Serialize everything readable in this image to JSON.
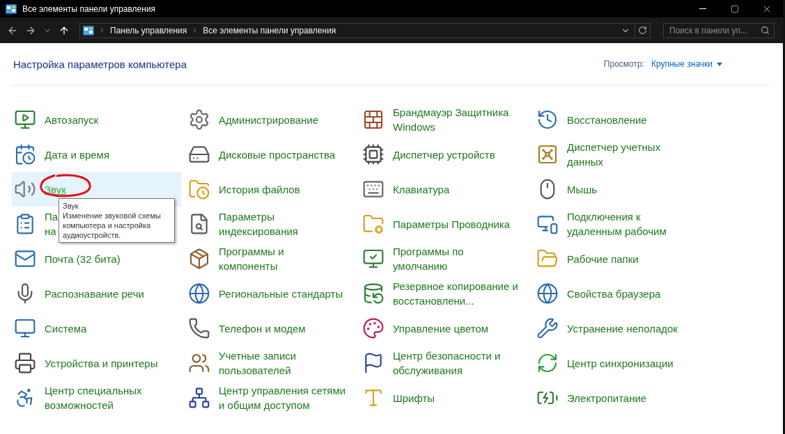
{
  "window": {
    "title": "Все элементы панели управления"
  },
  "breadcrumb": [
    "Панель управления",
    "Все элементы панели управления"
  ],
  "search": {
    "placeholder": "Поиск в панели уп..."
  },
  "heading": "Настройка параметров компьютера",
  "view": {
    "label": "Просмотр:",
    "value": "Крупные значки"
  },
  "items": [
    {
      "lines": [
        "Автозапуск"
      ],
      "hovered": false
    },
    {
      "lines": [
        "Администрирование"
      ],
      "hovered": false
    },
    {
      "lines": [
        "Брандмауэр Защитника",
        "Windows"
      ],
      "hovered": false
    },
    {
      "lines": [
        "Восстановление"
      ],
      "hovered": false
    },
    {
      "lines": [
        "Дата и время"
      ],
      "hovered": false
    },
    {
      "lines": [
        "Дисковые пространства"
      ],
      "hovered": false
    },
    {
      "lines": [
        "Диспетчер устройств"
      ],
      "hovered": false
    },
    {
      "lines": [
        "Диспетчер учетных",
        "данных"
      ],
      "hovered": false
    },
    {
      "lines": [
        "Звук"
      ],
      "hovered": true
    },
    {
      "lines": [
        "История файлов"
      ],
      "hovered": false
    },
    {
      "lines": [
        "Клавиатура"
      ],
      "hovered": false
    },
    {
      "lines": [
        "Мышь"
      ],
      "hovered": false
    },
    {
      "lines": [
        "Па",
        "на"
      ],
      "hovered": false
    },
    {
      "lines": [
        "Параметры",
        "индексирования"
      ],
      "hovered": false
    },
    {
      "lines": [
        "Параметры Проводника"
      ],
      "hovered": false
    },
    {
      "lines": [
        "Подключения к",
        "удаленным рабочим"
      ],
      "hovered": false
    },
    {
      "lines": [
        "Почта (32 бита)"
      ],
      "hovered": false
    },
    {
      "lines": [
        "Программы и",
        "компоненты"
      ],
      "hovered": false
    },
    {
      "lines": [
        "Программы по",
        "умолчанию"
      ],
      "hovered": false
    },
    {
      "lines": [
        "Рабочие папки"
      ],
      "hovered": false
    },
    {
      "lines": [
        "Распознавание речи"
      ],
      "hovered": false
    },
    {
      "lines": [
        "Региональные стандарты"
      ],
      "hovered": false
    },
    {
      "lines": [
        "Резервное копирование и",
        "восстановлени..."
      ],
      "hovered": false
    },
    {
      "lines": [
        "Свойства браузера"
      ],
      "hovered": false
    },
    {
      "lines": [
        "Система"
      ],
      "hovered": false
    },
    {
      "lines": [
        "Телефон и модем"
      ],
      "hovered": false
    },
    {
      "lines": [
        "Управление цветом"
      ],
      "hovered": false
    },
    {
      "lines": [
        "Устранение неполадок"
      ],
      "hovered": false
    },
    {
      "lines": [
        "Устройства и принтеры"
      ],
      "hovered": false
    },
    {
      "lines": [
        "Учетные записи",
        "пользователей"
      ],
      "hovered": false
    },
    {
      "lines": [
        "Центр безопасности и",
        "обслуживания"
      ],
      "hovered": false
    },
    {
      "lines": [
        "Центр синхронизации"
      ],
      "hovered": false
    },
    {
      "lines": [
        "Центр специальных",
        "возможностей"
      ],
      "hovered": false
    },
    {
      "lines": [
        "Центр управления сетями",
        "и общим доступом"
      ],
      "hovered": false
    },
    {
      "lines": [
        "Шрифты"
      ],
      "hovered": false
    },
    {
      "lines": [
        "Электропитание"
      ],
      "hovered": false
    }
  ],
  "tooltip": {
    "title": "Звук",
    "text": "Изменение звуковой схемы компьютера и настройка аудиоустройств."
  }
}
